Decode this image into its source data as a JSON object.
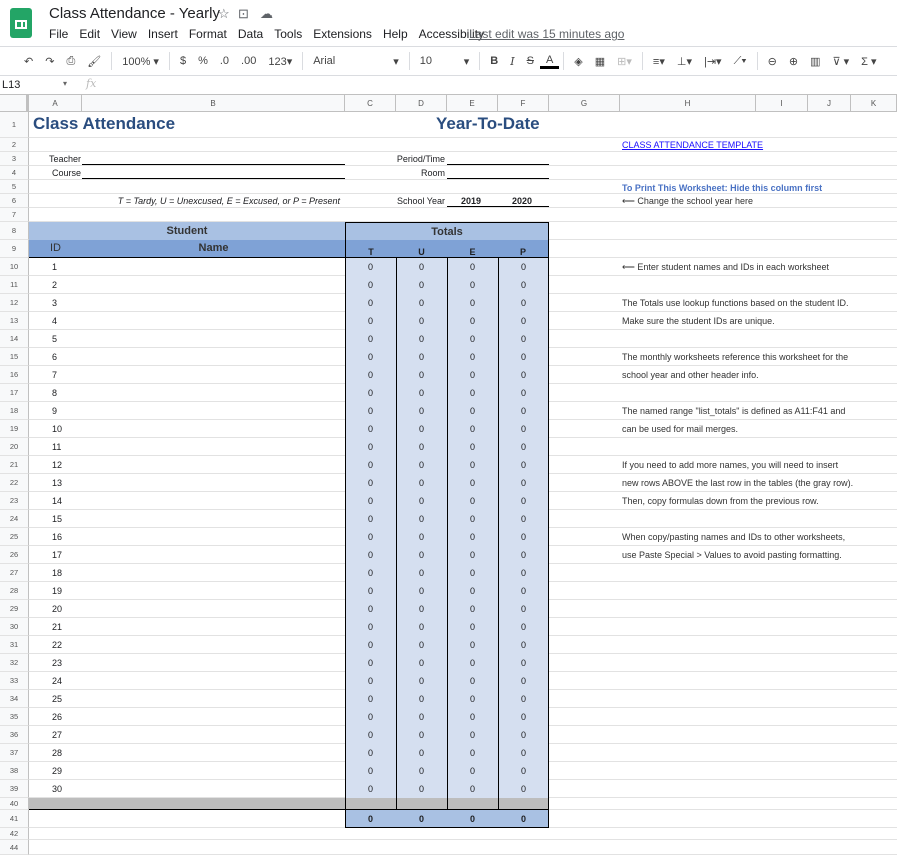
{
  "app": {
    "title": "Class Attendance - Yearly",
    "menu": [
      "File",
      "Edit",
      "View",
      "Insert",
      "Format",
      "Data",
      "Tools",
      "Extensions",
      "Help",
      "Accessibility"
    ],
    "last_edit": "Last edit was 15 minutes ago"
  },
  "toolbar": {
    "zoom": "100%",
    "currency": "$",
    "percent": "%",
    "dec_less": ".0",
    "dec_more": ".00",
    "format": "123",
    "font": "Arial",
    "size": "10",
    "bold": "B",
    "italic": "I",
    "strike": "S",
    "text_color": "A"
  },
  "formula_bar": {
    "cell_ref": "L13",
    "fx": "fx",
    "value": ""
  },
  "columns": [
    "A",
    "B",
    "C",
    "D",
    "E",
    "F",
    "G",
    "H",
    "I",
    "J",
    "K"
  ],
  "sheet": {
    "title": "Class Attendance",
    "subtitle": "Year-To-Date",
    "teacher_label": "Teacher",
    "course_label": "Course",
    "period_label": "Period/Time",
    "room_label": "Room",
    "legend": "T = Tardy,  U = Unexcused,  E = Excused,  or P = Present",
    "school_year_label": "School Year",
    "year_start": "2019",
    "year_end": "2020",
    "student_header": "Student",
    "totals_header": "Totals",
    "id_header": "ID",
    "name_header": "Name",
    "total_cols": [
      "T",
      "U",
      "E",
      "P"
    ],
    "students": [
      1,
      2,
      3,
      4,
      5,
      6,
      7,
      8,
      9,
      10,
      11,
      12,
      13,
      14,
      15,
      16,
      17,
      18,
      19,
      20,
      21,
      22,
      23,
      24,
      25,
      26,
      27,
      28,
      29,
      30
    ],
    "student_value": "0",
    "grand_totals": [
      "0",
      "0",
      "0",
      "0"
    ]
  },
  "row_numbers": [
    "1",
    "2",
    "3",
    "4",
    "5",
    "6",
    "7",
    "8",
    "9",
    "10",
    "11",
    "12",
    "13",
    "14",
    "15",
    "16",
    "17",
    "18",
    "19",
    "20",
    "21",
    "22",
    "23",
    "24",
    "25",
    "26",
    "27",
    "28",
    "29",
    "30",
    "31",
    "32",
    "33",
    "34",
    "35",
    "36",
    "37",
    "38",
    "39",
    "40",
    "41",
    "42",
    "44"
  ],
  "notes": {
    "link": "CLASS ATTENDANCE TEMPLATE",
    "print": "To Print This Worksheet: Hide this column first",
    "year": "⟵ Change the school year here",
    "names": "⟵ Enter student names and IDs in each worksheet",
    "totals1": "The Totals use lookup functions based on the student ID.",
    "totals2": "Make sure the student IDs are unique.",
    "monthly1": "The monthly worksheets reference this worksheet for the",
    "monthly2": "school year and other header info.",
    "range1": "The named range \"list_totals\" is defined as A11:F41 and",
    "range2": "can be used for mail merges.",
    "more1": "If you need to add more names, you will need to insert",
    "more2": "new rows ABOVE the last row in the tables (the gray row).",
    "more3": "Then, copy formulas down from the previous row.",
    "copy1": "When copy/pasting names and IDs to other worksheets,",
    "copy2": "use Paste Special > Values to avoid pasting formatting."
  },
  "colors": {
    "header_light": "#a9c1e3",
    "header_dark": "#7fa2d6",
    "totals_fill": "#d5dff0",
    "gray_row": "#bdbdbd",
    "title": "#2a4d7f",
    "note_blue": "#4a72c4"
  }
}
